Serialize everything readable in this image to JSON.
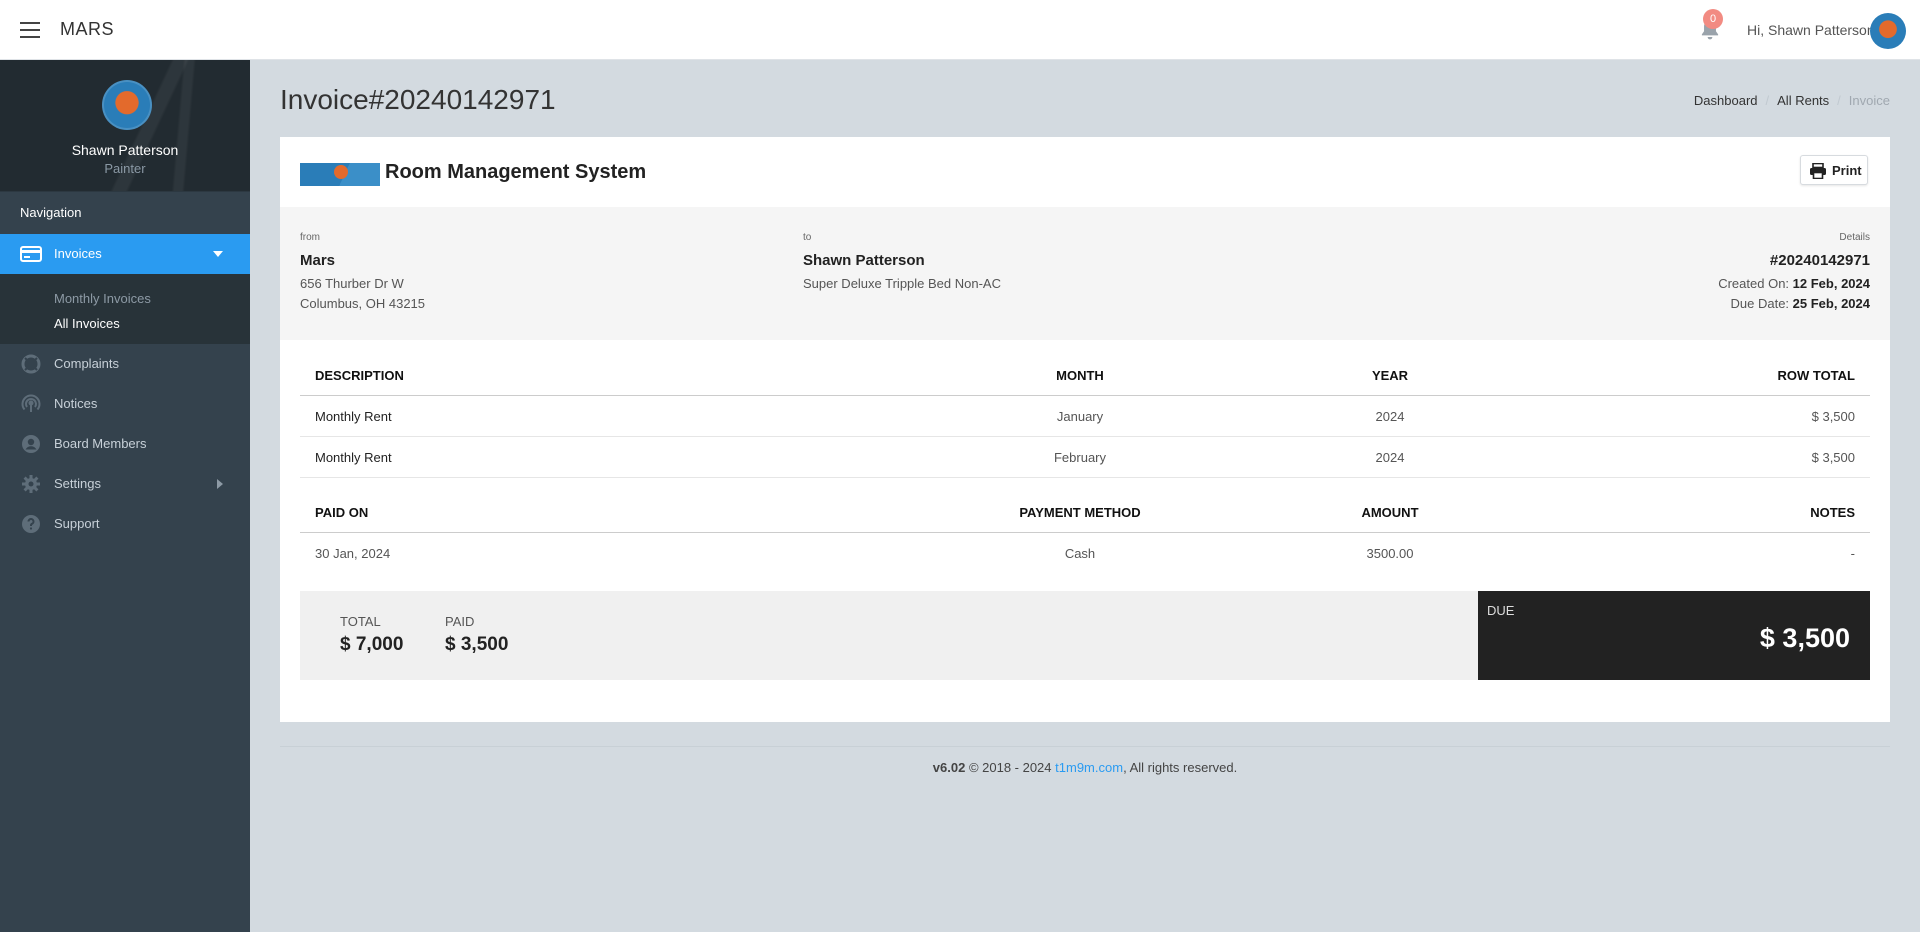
{
  "topbar": {
    "app_title": "MARS",
    "notification_count": "0",
    "greeting": "Hi, Shawn Patterson"
  },
  "sidebar": {
    "profile_name": "Shawn Patterson",
    "profile_role": "Painter",
    "nav_header": "Navigation",
    "active_item": "Invoices",
    "submenu": [
      "Monthly Invoices",
      "All Invoices"
    ],
    "items": [
      {
        "label": "Complaints",
        "icon": "lifebuoy-icon"
      },
      {
        "label": "Notices",
        "icon": "broadcast-icon"
      },
      {
        "label": "Board Members",
        "icon": "user-circle-icon"
      },
      {
        "label": "Settings",
        "icon": "gear-icon"
      },
      {
        "label": "Support",
        "icon": "question-circle-icon"
      }
    ]
  },
  "page": {
    "title": "Invoice#20240142971",
    "breadcrumb": [
      "Dashboard",
      "All Rents",
      "Invoice"
    ]
  },
  "invoice": {
    "system_title": "Room Management System",
    "print_label": "Print",
    "from_label": "from",
    "from_name": "Mars",
    "from_address1": "656 Thurber Dr W",
    "from_address2": "Columbus, OH 43215",
    "to_label": "to",
    "to_name": "Shawn Patterson",
    "to_room": "Super Deluxe Tripple Bed Non-AC",
    "details_label": "Details",
    "number": "#20240142971",
    "created_label": "Created On:",
    "created_value": "12 Feb, 2024",
    "due_label": "Due Date:",
    "due_value": "25 Feb, 2024",
    "item_headers": [
      "DESCRIPTION",
      "MONTH",
      "YEAR",
      "ROW TOTAL"
    ],
    "items": [
      [
        "Monthly Rent",
        "January",
        "2024",
        "$ 3,500"
      ],
      [
        "Monthly Rent",
        "February",
        "2024",
        "$ 3,500"
      ]
    ],
    "payment_headers": [
      "PAID ON",
      "PAYMENT METHOD",
      "AMOUNT",
      "NOTES"
    ],
    "payments": [
      [
        "30 Jan, 2024",
        "Cash",
        "3500.00",
        "-"
      ]
    ],
    "total_label": "TOTAL",
    "total_value": "$ 7,000",
    "paid_label": "PAID",
    "paid_value": "$ 3,500",
    "due_box_label": "DUE",
    "due_box_value": "$ 3,500"
  },
  "footer": {
    "version": "v6.02",
    "copyright": "© 2018 - 2024",
    "link": "t1m9m.com",
    "rights": ", All rights reserved."
  },
  "colors": {
    "accent": "#2a9bf1",
    "sidebar": "#34424d",
    "sidebar_dark": "#222b31",
    "background": "#d3dae0",
    "due_box": "#222222"
  }
}
